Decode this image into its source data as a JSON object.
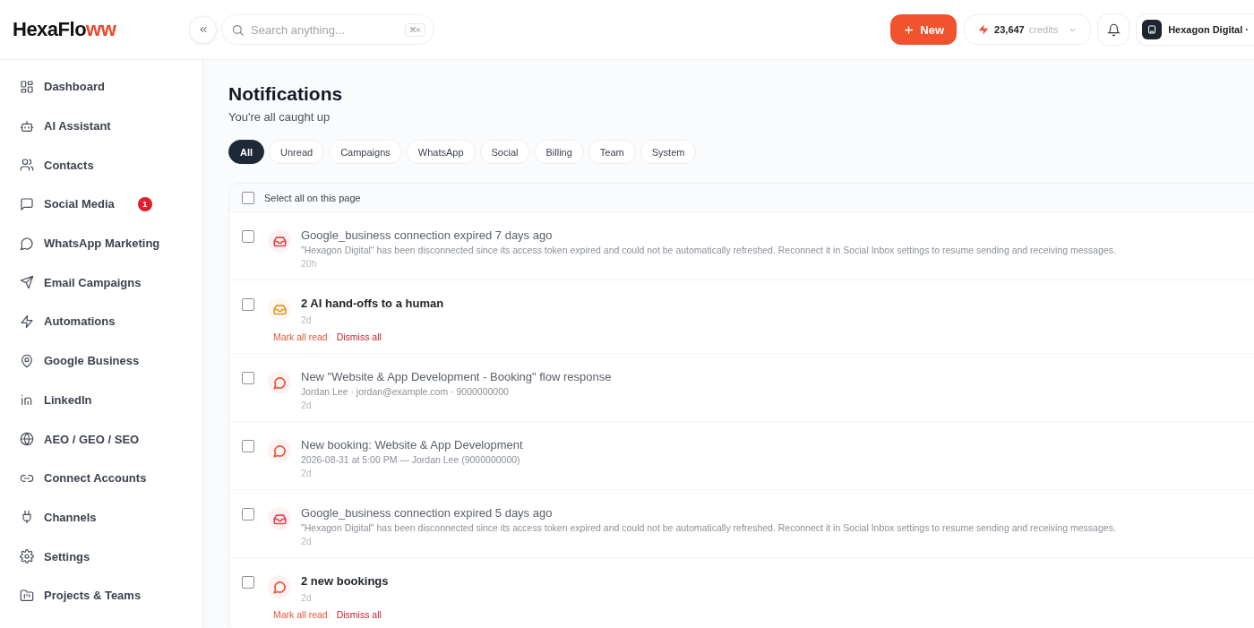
{
  "logo": {
    "text": "HexaFlo",
    "accent": "ww"
  },
  "search": {
    "placeholder": "Search anything...",
    "shortcut": "⌘K"
  },
  "header": {
    "new_button": "New",
    "credits": {
      "amount": "23,647",
      "label": "credits"
    },
    "account": "Hexagon Digital ·"
  },
  "sidebar": {
    "items": [
      {
        "label": "Dashboard"
      },
      {
        "label": "AI Assistant"
      },
      {
        "label": "Contacts"
      },
      {
        "label": "Social Media",
        "badge": "1"
      },
      {
        "label": "WhatsApp Marketing"
      },
      {
        "label": "Email Campaigns"
      },
      {
        "label": "Automations"
      },
      {
        "label": "Google Business"
      },
      {
        "label": "LinkedIn"
      },
      {
        "label": "AEO / GEO / SEO"
      },
      {
        "label": "Connect Accounts"
      },
      {
        "label": "Channels"
      },
      {
        "label": "Settings"
      },
      {
        "label": "Projects & Teams"
      }
    ]
  },
  "page": {
    "title": "Notifications",
    "subtitle": "You're all caught up"
  },
  "filters": [
    {
      "label": "All",
      "selected": true
    },
    {
      "label": "Unread",
      "selected": false
    },
    {
      "label": "Campaigns",
      "selected": false
    },
    {
      "label": "WhatsApp",
      "selected": false
    },
    {
      "label": "Social",
      "selected": false
    },
    {
      "label": "Billing",
      "selected": false
    },
    {
      "label": "Team",
      "selected": false
    },
    {
      "label": "System",
      "selected": false
    }
  ],
  "select_all": {
    "label": "Select all on this page",
    "checked": false
  },
  "notifications": [
    {
      "kind": "inbox",
      "color": "#e5484d",
      "read": true,
      "checked": false,
      "title": "Google_business connection expired 7 days ago",
      "description": "\"Hexagon Digital\" has been disconnected since its access token expired and could not be automatically refreshed. Reconnect it in Social Inbox settings to resume sending and receiving messages.",
      "time": "20h"
    },
    {
      "kind": "inbox",
      "color": "#e09a2c",
      "read": false,
      "checked": false,
      "title": "2 AI hand-offs to a human",
      "time": "2d",
      "actions": [
        "Mark all read",
        "Dismiss all"
      ]
    },
    {
      "kind": "chat",
      "color": "#e8553a",
      "read": true,
      "checked": false,
      "title": "New \"Website & App Development - Booking\" flow response",
      "description": "Jordan Lee · jordan@example.com · 9000000000",
      "time": "2d"
    },
    {
      "kind": "chat",
      "color": "#e8553a",
      "read": true,
      "checked": false,
      "title": "New booking: Website & App Development",
      "description": "2026-08-31 at 5:00 PM — Jordan Lee (9000000000)",
      "time": "2d"
    },
    {
      "kind": "inbox",
      "color": "#e5484d",
      "read": true,
      "checked": false,
      "title": "Google_business connection expired 5 days ago",
      "description": "\"Hexagon Digital\" has been disconnected since its access token expired and could not be automatically refreshed. Reconnect it in Social Inbox settings to resume sending and receiving messages.",
      "time": "2d"
    },
    {
      "kind": "chat",
      "color": "#e8553a",
      "read": false,
      "checked": false,
      "title": "2 new bookings",
      "time": "2d",
      "actions": [
        "Mark all read",
        "Dismiss all"
      ]
    }
  ]
}
